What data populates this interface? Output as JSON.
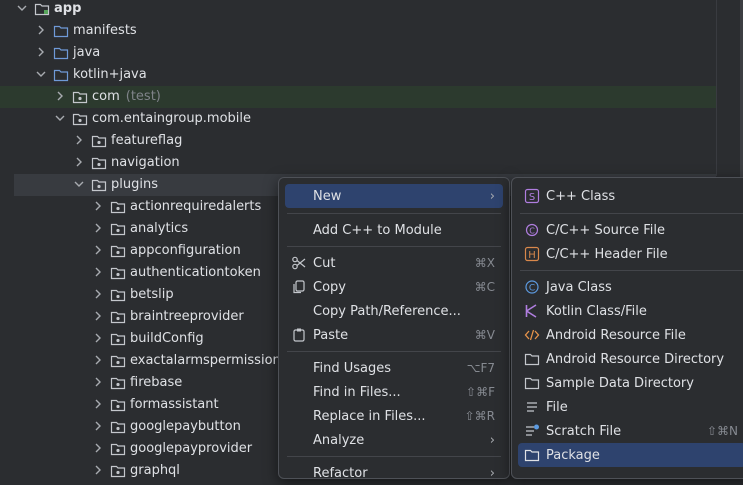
{
  "tree": [
    {
      "label": "app",
      "expanded": true,
      "icon": "module-folder-icon",
      "bold": true
    },
    {
      "label": "manifests",
      "expanded": false,
      "icon": "folder-icon"
    },
    {
      "label": "java",
      "expanded": false,
      "icon": "folder-icon"
    },
    {
      "label": "kotlin+java",
      "expanded": true,
      "icon": "folder-icon"
    },
    {
      "label": "com",
      "suffix": "(test)",
      "expanded": false,
      "icon": "package-icon"
    },
    {
      "label": "com.entaingroup.mobile",
      "expanded": true,
      "icon": "package-icon"
    },
    {
      "label": "featureflag",
      "expanded": false,
      "icon": "package-icon"
    },
    {
      "label": "navigation",
      "expanded": false,
      "icon": "package-icon"
    },
    {
      "label": "plugins",
      "expanded": true,
      "icon": "package-icon"
    },
    {
      "label": "actionrequiredalerts",
      "expanded": false,
      "icon": "package-icon"
    },
    {
      "label": "analytics",
      "expanded": false,
      "icon": "package-icon"
    },
    {
      "label": "appconfiguration",
      "expanded": false,
      "icon": "package-icon"
    },
    {
      "label": "authenticationtoken",
      "expanded": false,
      "icon": "package-icon"
    },
    {
      "label": "betslip",
      "expanded": false,
      "icon": "package-icon"
    },
    {
      "label": "braintreeprovider",
      "expanded": false,
      "icon": "package-icon"
    },
    {
      "label": "buildConfig",
      "expanded": false,
      "icon": "package-icon"
    },
    {
      "label": "exactalarmspermission",
      "expanded": false,
      "icon": "package-icon"
    },
    {
      "label": "firebase",
      "expanded": false,
      "icon": "package-icon"
    },
    {
      "label": "formassistant",
      "expanded": false,
      "icon": "package-icon"
    },
    {
      "label": "googlepaybutton",
      "expanded": false,
      "icon": "package-icon"
    },
    {
      "label": "googlepayprovider",
      "expanded": false,
      "icon": "package-icon"
    },
    {
      "label": "graphql",
      "expanded": false,
      "icon": "package-icon"
    }
  ],
  "context_menu": {
    "items": [
      {
        "label": "New",
        "shortcut": "",
        "submenu": true,
        "icon": "",
        "selected": true
      },
      {
        "label": "Add C++ to Module",
        "shortcut": "",
        "submenu": false,
        "icon": ""
      },
      {
        "label": "Cut",
        "shortcut": "⌘X",
        "submenu": false,
        "icon": "scissors-icon"
      },
      {
        "label": "Copy",
        "shortcut": "⌘C",
        "submenu": false,
        "icon": "copy-icon"
      },
      {
        "label": "Copy Path/Reference...",
        "shortcut": "",
        "submenu": false,
        "icon": ""
      },
      {
        "label": "Paste",
        "shortcut": "⌘V",
        "submenu": false,
        "icon": "clipboard-icon"
      },
      {
        "label": "Find Usages",
        "shortcut": "⌥F7",
        "submenu": false,
        "icon": ""
      },
      {
        "label": "Find in Files...",
        "shortcut": "⇧⌘F",
        "submenu": false,
        "icon": ""
      },
      {
        "label": "Replace in Files...",
        "shortcut": "⇧⌘R",
        "submenu": false,
        "icon": ""
      },
      {
        "label": "Analyze",
        "shortcut": "",
        "submenu": true,
        "icon": ""
      },
      {
        "label": "Refactor",
        "shortcut": "",
        "submenu": true,
        "icon": ""
      }
    ]
  },
  "new_submenu": {
    "items": [
      {
        "label": "C++ Class",
        "shortcut": "",
        "icon": "cpp-class-icon"
      },
      {
        "label": "C/C++ Source File",
        "shortcut": "",
        "icon": "cpp-source-icon"
      },
      {
        "label": "C/C++ Header File",
        "shortcut": "",
        "icon": "cpp-header-icon"
      },
      {
        "label": "Java Class",
        "shortcut": "",
        "icon": "java-class-icon"
      },
      {
        "label": "Kotlin Class/File",
        "shortcut": "",
        "icon": "kotlin-icon"
      },
      {
        "label": "Android Resource File",
        "shortcut": "",
        "icon": "resource-file-icon"
      },
      {
        "label": "Android Resource Directory",
        "shortcut": "",
        "icon": "folder-icon"
      },
      {
        "label": "Sample Data Directory",
        "shortcut": "",
        "icon": "folder-icon"
      },
      {
        "label": "File",
        "shortcut": "",
        "icon": "file-icon"
      },
      {
        "label": "Scratch File",
        "shortcut": "⇧⌘N",
        "icon": "scratch-file-icon"
      },
      {
        "label": "Package",
        "shortcut": "",
        "icon": "folder-icon",
        "selected": true
      }
    ]
  },
  "colors": {
    "accent": "#2e436e",
    "background": "#2b2d30",
    "text": "#dfe1e5"
  }
}
